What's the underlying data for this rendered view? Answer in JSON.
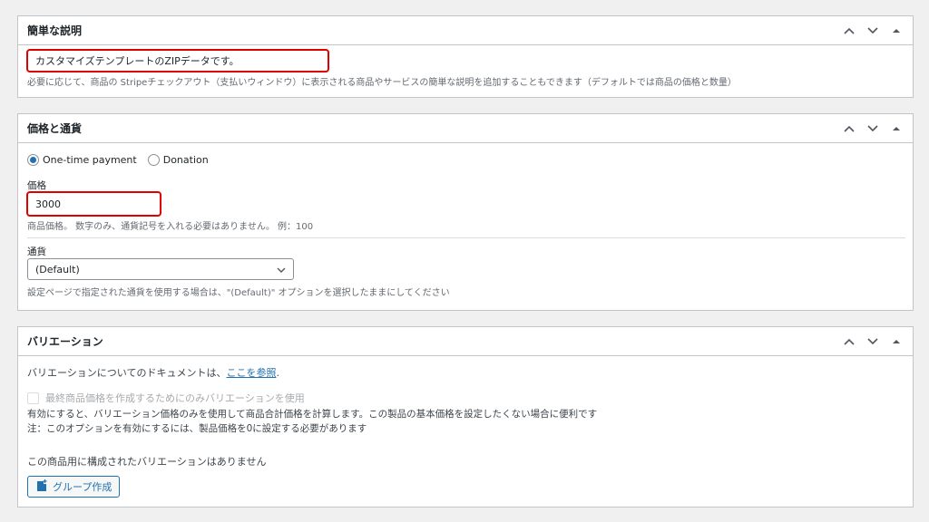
{
  "panels": {
    "short_description": {
      "title": "簡単な説明",
      "value": "カスタマイズテンプレートのZIPデータです。",
      "help": "必要に応じて、商品の Stripeチェックアウト（支払いウィンドウ）に表示される商品やサービスの簡単な説明を追加することもできます（デフォルトでは商品の価格と数量）"
    },
    "price_currency": {
      "title": "価格と通貨",
      "payment_types": [
        {
          "label": "One-time payment",
          "checked": true
        },
        {
          "label": "Donation",
          "checked": false
        }
      ],
      "price_label": "価格",
      "price_value": "3000",
      "price_help": "商品価格。 数字のみ、通貨記号を入れる必要はありません。 例：100",
      "currency_label": "通貨",
      "currency_selected": "(Default)",
      "currency_help": "設定ページで指定された通貨を使用する場合は、\"(Default)\" オプションを選択したままにしてください"
    },
    "variations": {
      "title": "バリエーション",
      "doc_text": "バリエーションについてのドキュメントは、",
      "doc_link": "ここを参照",
      "doc_suffix": ".",
      "checkbox_label": "最終商品価格を作成するためにのみバリエーションを使用",
      "checkbox_checked": false,
      "help1": "有効にすると、バリエーション価格のみを使用して商品合計価格を計算します。この製品の基本価格を設定したくない場合に便利です",
      "help2": "注：このオプションを有効にするには、製品価格を0に設定する必要があります",
      "empty_text": "この商品用に構成されたバリエーションはありません",
      "create_group_button": "グループ作成"
    }
  },
  "colors": {
    "accent": "#2271b1",
    "highlight": "#e10000"
  }
}
